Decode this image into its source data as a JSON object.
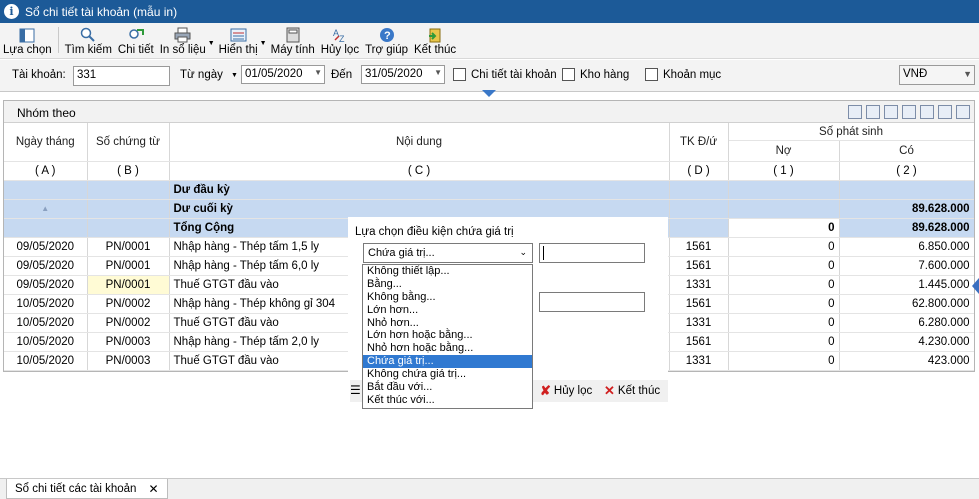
{
  "window": {
    "title": "Sổ chi tiết tài khoản (mẫu in)"
  },
  "toolbar": {
    "buttons": [
      {
        "label": "Lựa chọn",
        "icon": "select-icon"
      },
      {
        "label": "Tìm kiếm",
        "icon": "search-icon"
      },
      {
        "label": "Chi tiết",
        "icon": "detail-icon"
      },
      {
        "label": "In sổ liệu",
        "icon": "print-icon"
      },
      {
        "label": "Hiển thị",
        "icon": "display-icon"
      },
      {
        "label": "Máy tính",
        "icon": "calculator-icon"
      },
      {
        "label": "Hủy lọc",
        "icon": "clear-filter-icon"
      },
      {
        "label": "Trợ giúp",
        "icon": "help-icon"
      },
      {
        "label": "Kết thúc",
        "icon": "exit-icon"
      }
    ]
  },
  "filter": {
    "account_label": "Tài khoản:",
    "account_value": "331",
    "from_label": "Từ ngày",
    "from_value": "01/05/2020",
    "to_label": "Đến",
    "to_value": "31/05/2020",
    "detail_account": "Chi tiết tài khoản",
    "warehouse": "Kho hàng",
    "item": "Khoản mục",
    "currency": "VNĐ"
  },
  "grid": {
    "group_label": "Nhóm theo",
    "headers": {
      "date": "Ngày tháng",
      "voucher": "Số chứng từ",
      "content": "Nội dung",
      "account": "TK Đ/ứ",
      "amount": "Số phát sinh",
      "debit": "Nợ",
      "credit": "Có"
    },
    "codes": {
      "a": "( A )",
      "b": "( B )",
      "c": "( C )",
      "d": "( D )",
      "e": "( 1 )",
      "f": "( 2 )"
    },
    "summary": {
      "opening": "Dư đầu kỳ",
      "closing": "Dư cuối kỳ",
      "closing_credit": "89.628.000",
      "total": "Tổng Cộng",
      "total_debit": "0",
      "total_credit": "89.628.000"
    },
    "rows": [
      {
        "date": "09/05/2020",
        "voucher": "PN/0001",
        "content": "Nhập hàng - Thép tấm 1,5 ly",
        "account": "1561",
        "debit": "0",
        "credit": "6.850.000"
      },
      {
        "date": "09/05/2020",
        "voucher": "PN/0001",
        "content": "Nhập hàng - Thép tấm 6,0 ly",
        "account": "1561",
        "debit": "0",
        "credit": "7.600.000"
      },
      {
        "date": "09/05/2020",
        "voucher": "PN/0001",
        "content": "Thuế GTGT đầu vào",
        "account": "1331",
        "debit": "0",
        "credit": "1.445.000"
      },
      {
        "date": "10/05/2020",
        "voucher": "PN/0002",
        "content": "Nhập hàng - Thép không gỉ 304",
        "account": "1561",
        "debit": "0",
        "credit": "62.800.000"
      },
      {
        "date": "10/05/2020",
        "voucher": "PN/0002",
        "content": "Thuế GTGT đầu vào",
        "account": "1331",
        "debit": "0",
        "credit": "6.280.000"
      },
      {
        "date": "10/05/2020",
        "voucher": "PN/0003",
        "content": "Nhập hàng - Thép tấm 2,0 ly",
        "account": "1561",
        "debit": "0",
        "credit": "4.230.000"
      },
      {
        "date": "10/05/2020",
        "voucher": "PN/0003",
        "content": "Thuế GTGT đầu vào",
        "account": "1331",
        "debit": "0",
        "credit": "423.000"
      }
    ]
  },
  "dialog": {
    "title": "Lựa chọn điều kiện chứa giá trị",
    "selected": "Chứa giá trị...",
    "options": [
      "Không thiết lập...",
      "Bằng...",
      "Không bằng...",
      "Lớn hơn...",
      "Nhỏ hơn...",
      "Lớn hơn hoặc bằng...",
      "Nhỏ hơn hoặc bằng...",
      "Chứa giá trị...",
      "Không chứa giá trị...",
      "Bắt đầu với...",
      "Kết thúc với..."
    ],
    "selected_index": 7,
    "clear_button": "Hủy lọc",
    "close_button": "Kết thúc"
  },
  "bottom": {
    "tab_label": "Sổ chi tiết các tài khoản"
  },
  "colors": {
    "titlebar": "#1c5a98",
    "summary_row": "#c6d9f1",
    "selection": "#3079d1"
  }
}
